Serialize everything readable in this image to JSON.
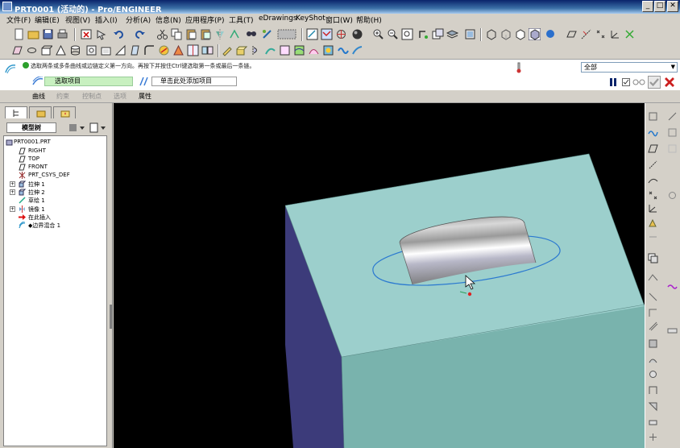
{
  "window": {
    "title": "PRT0001 (活动的) - Pro/ENGINEER",
    "controls": [
      "_",
      "□",
      "✕"
    ]
  },
  "menu": [
    "文件(F)",
    "编辑(E)",
    "视图(V)",
    "插入(I)",
    "分析(A)",
    "信息(N)",
    "应用程序(P)",
    "工具(T)",
    "eDrawings",
    "KeyShot",
    "窗口(W)",
    "帮助(H)"
  ],
  "dashboard": {
    "prompt": "选取两条或多条曲线或边链定义第一方向。再按下并按住Ctrl键选取第一条或最后一条链。",
    "filter_value": "全部",
    "first_direction_field": "选取项目",
    "second_direction_field": "单击此处添加项目",
    "tabs": [
      {
        "label": "曲线",
        "enabled": true
      },
      {
        "label": "约束",
        "enabled": false
      },
      {
        "label": "控制点",
        "enabled": false
      },
      {
        "label": "选项",
        "enabled": false
      },
      {
        "label": "属性",
        "enabled": true
      }
    ],
    "colors": {
      "ok": "#2aa52a",
      "cancel": "#cc1f1f",
      "pause": "#0a246a"
    }
  },
  "sidebar": {
    "active_tab": "模型树",
    "tree_title": "模型树",
    "items": [
      {
        "label": "PRT0001.PRT",
        "icon": "part-icon",
        "expandable": false
      },
      {
        "label": "RIGHT",
        "icon": "datum-plane-icon",
        "expandable": false
      },
      {
        "label": "TOP",
        "icon": "datum-plane-icon",
        "expandable": false
      },
      {
        "label": "FRONT",
        "icon": "datum-plane-icon",
        "expandable": false
      },
      {
        "label": "PRT_CSYS_DEF",
        "icon": "csys-icon",
        "expandable": false
      },
      {
        "label": "拉伸 1",
        "icon": "extrude-icon",
        "expandable": true
      },
      {
        "label": "拉伸 2",
        "icon": "extrude-icon",
        "expandable": true
      },
      {
        "label": "草绘 1",
        "icon": "sketch-icon",
        "expandable": false
      },
      {
        "label": "镜像 1",
        "icon": "mirror-icon",
        "expandable": true
      },
      {
        "label": "在此插入",
        "icon": "insert-arrow-icon",
        "expandable": false
      },
      {
        "label": "◆边界混合 1",
        "icon": "boundary-blend-icon",
        "expandable": false
      }
    ]
  },
  "viewport": {
    "background": "#000000",
    "model_top_color": "#9ccfcc",
    "model_front_color": "#79b3ad",
    "model_side_color": "#3c3b7a"
  }
}
